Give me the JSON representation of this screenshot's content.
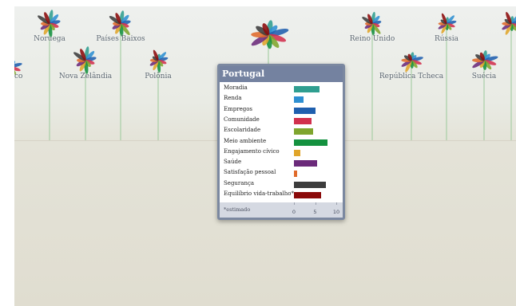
{
  "countries": [
    "Noruega",
    "Países Baixos",
    "Reino Unido",
    "Rússia",
    "México",
    "Nova Zelândia",
    "Polônia",
    "República Tcheca",
    "Suécia"
  ],
  "popup": {
    "title": "Portugal",
    "footnote": "*estimado"
  },
  "chart_data": {
    "type": "bar",
    "orientation": "horizontal",
    "title": "Portugal",
    "categories": [
      "Moradia",
      "Renda",
      "Empregos",
      "Comunidade",
      "Escolaridade",
      "Meio ambiente",
      "Engajamento cívico",
      "Saúde",
      "Satisfação pessoal",
      "Segurança",
      "Equilíbrio vida-trabalho*"
    ],
    "values": [
      6.0,
      2.3,
      5.1,
      4.1,
      4.5,
      8.0,
      1.5,
      5.4,
      0.8,
      7.6,
      6.5
    ],
    "colors": [
      "#2f9e90",
      "#2e8fd1",
      "#1f5fae",
      "#d1304d",
      "#7fa52e",
      "#14913f",
      "#e0a52a",
      "#6b2a7a",
      "#e06a2a",
      "#3c3c3c",
      "#8b0a0a"
    ],
    "xlim": [
      0,
      10
    ],
    "xticks": [
      "0",
      "5",
      "10"
    ],
    "note": "*estimado"
  }
}
